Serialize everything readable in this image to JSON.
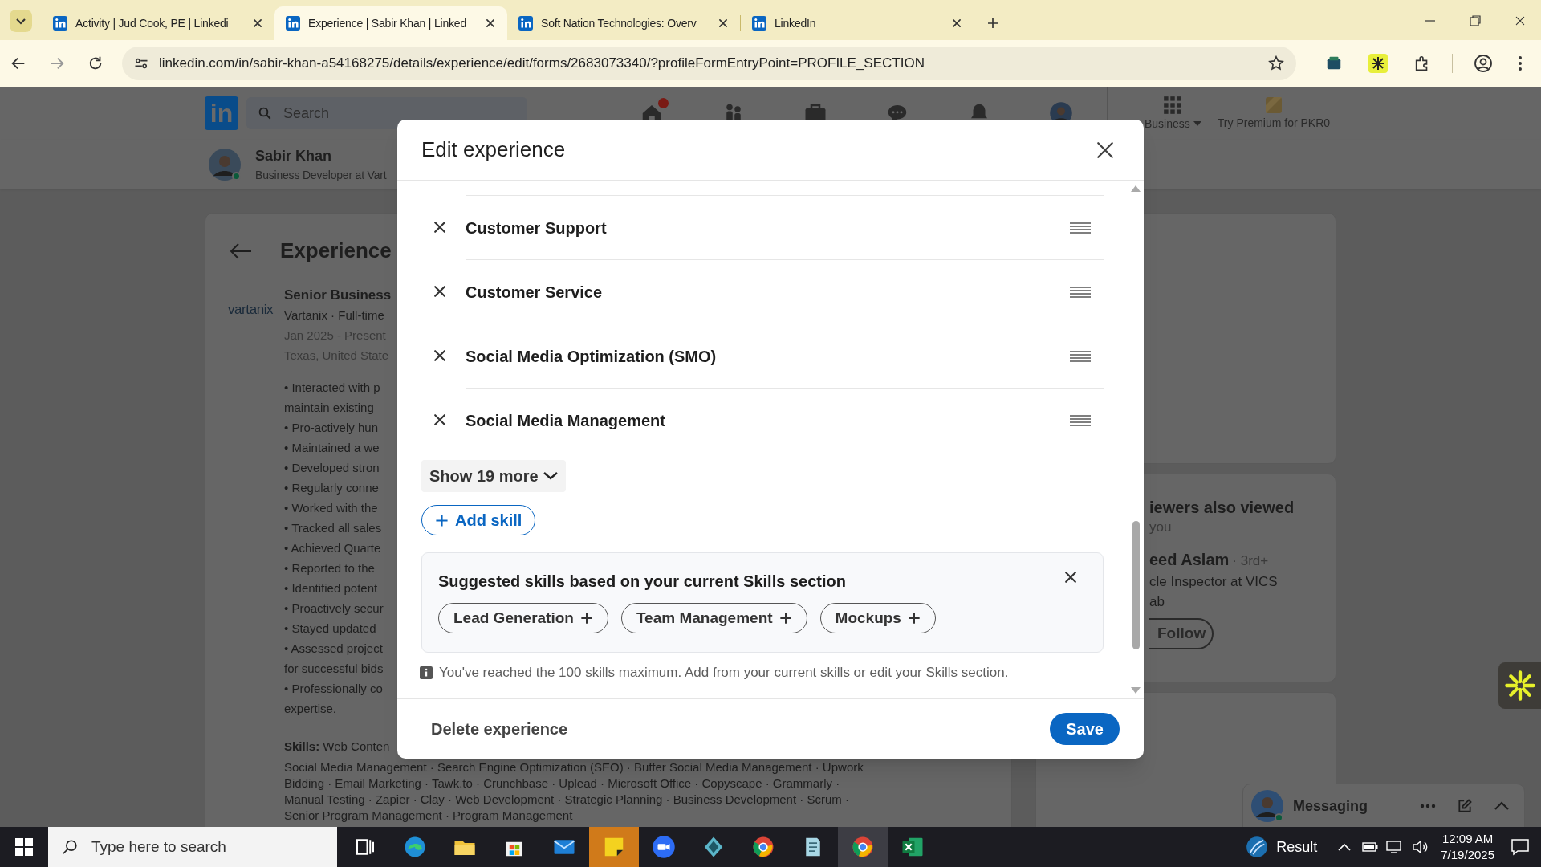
{
  "browser": {
    "tabs": [
      {
        "title": "Activity | Jud Cook, PE | Linkedi",
        "selected": false
      },
      {
        "title": "Experience | Sabir Khan | Linked",
        "selected": true
      },
      {
        "title": "Soft Nation Technologies: Overv",
        "selected": false
      },
      {
        "title": "LinkedIn",
        "selected": false
      }
    ],
    "url": "linkedin.com/in/sabir-khan-a54168275/details/experience/edit/forms/2683073340/?profileFormEntryPoint=PROFILE_SECTION"
  },
  "header": {
    "logo": "in",
    "search_placeholder": "Search",
    "nav": [
      {
        "kind": "home",
        "badge": true
      },
      {
        "kind": "network",
        "badge": false
      },
      {
        "kind": "jobs",
        "badge": false
      },
      {
        "kind": "messaging",
        "badge": false
      },
      {
        "kind": "notifications",
        "badge": false
      },
      {
        "kind": "me",
        "badge": false
      }
    ],
    "business": "Business",
    "premium": "Try Premium for PKR0"
  },
  "profile_bar": {
    "name": "Sabir Khan",
    "headline": "Business Developer at Vart"
  },
  "experience": {
    "title": "Experience",
    "logo": "vartanix",
    "position": "Senior Business",
    "company": "Vartanix · Full-time",
    "dates": "Jan 2025 - Present",
    "location": "Texas, United State",
    "bullets": [
      "• Interacted with p",
      "maintain existing",
      "• Pro-actively hun",
      "• Maintained a we",
      "• Developed stron",
      "• Regularly conne",
      "• Worked with the",
      "• Tracked all sales",
      "• Achieved Quarte",
      "• Reported to the",
      "• Identified potent",
      "• Proactively secur",
      "• Stayed updated",
      "• Assessed project",
      "for successful bids",
      "• Professionally co",
      "expertise."
    ],
    "skills_lines": [
      "**Skills:** Web Conten",
      "Social Media Management · Search Engine Optimization (SEO) · Buffer Social Media Management · Upwork",
      "Bidding · Email Marketing · Tawk.to · Crunchbase · Uplead · Microsoft Office · Copyscape · Grammarly ·",
      "Manual Testing · Zapier · Clay · Web Development · Strategic Planning · Business Development · Scrum ·",
      "Senior Program Management · Program Management"
    ]
  },
  "sidebar": {
    "heading": "iewers also viewed",
    "subheading": "you",
    "person": {
      "name": "eed Aslam",
      "degree": "· 3rd+",
      "headline": "cle Inspector at VICS",
      "location": "ab",
      "follow": "Follow"
    }
  },
  "messaging": {
    "label": "Messaging"
  },
  "modal": {
    "title": "Edit experience",
    "skills": [
      "Customer Support",
      "Customer Service",
      "Social Media Optimization (SMO)",
      "Social Media Management"
    ],
    "show_more": "Show 19 more",
    "add_skill": "Add skill",
    "suggestions": {
      "title": "Suggested skills based on your current Skills section",
      "chips": [
        "Lead Generation",
        "Team Management",
        "Mockups"
      ]
    },
    "info": "You've reached the 100 skills maximum. Add from your current skills or edit your Skills section.",
    "delete": "Delete experience",
    "save": "Save"
  },
  "taskbar": {
    "search_placeholder": "Type here to search",
    "apps": [
      {
        "kind": "taskview",
        "active": false
      },
      {
        "kind": "edge",
        "active": false
      },
      {
        "kind": "explorer",
        "active": false
      },
      {
        "kind": "store",
        "active": false
      },
      {
        "kind": "mail",
        "active": false
      },
      {
        "kind": "sticky",
        "active": true
      },
      {
        "kind": "zoom",
        "active": false
      },
      {
        "kind": "diamond",
        "active": false
      },
      {
        "kind": "chrome",
        "active": false
      },
      {
        "kind": "notes",
        "active": false
      },
      {
        "kind": "chrome",
        "active": true
      },
      {
        "kind": "excel",
        "active": false
      }
    ],
    "weather": "Result",
    "time": "12:09 AM",
    "date": "7/19/2025"
  }
}
